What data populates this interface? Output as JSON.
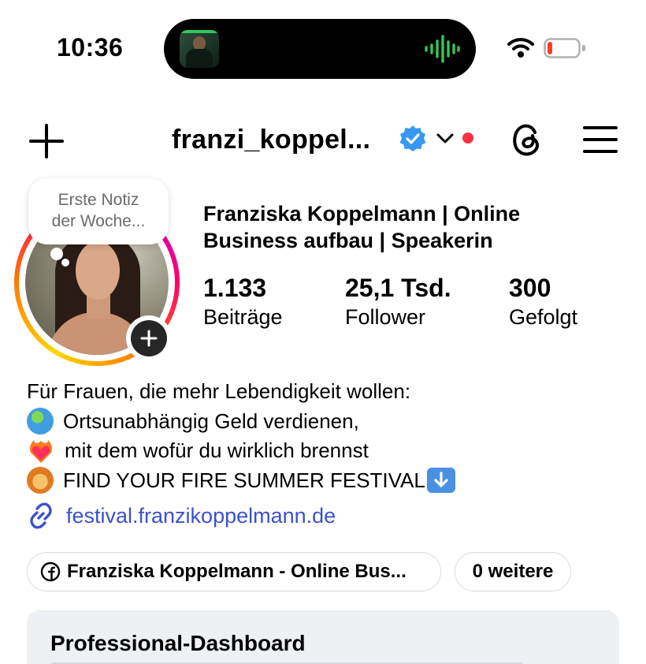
{
  "status_bar": {
    "time": "10:36"
  },
  "header": {
    "username": "franzi_koppel...",
    "verified": true,
    "notification_dot_color": "#ff3040"
  },
  "profile": {
    "note": {
      "line1": "Erste Notiz",
      "line2": "der Woche..."
    },
    "display_name": "Franziska Koppelmann | Online Business aufbau | Speakerin",
    "stats": [
      {
        "value": "1.133",
        "label": "Beiträge"
      },
      {
        "value": "25,1 Tsd.",
        "label": "Follower"
      },
      {
        "value": "300",
        "label": "Gefolgt"
      }
    ]
  },
  "bio": {
    "line1": "Für Frauen, die mehr Lebendigkeit wollen:",
    "line2": "Ortsunabhängig Geld verdienen,",
    "line3": "mit dem wofür du wirklich brennst",
    "line4": "FIND YOUR FIRE SUMMER FESTIVAL",
    "emojis": [
      "globe-emoji",
      "heart-on-fire-emoji",
      "lion-emoji",
      "down-arrow-emoji"
    ]
  },
  "link": {
    "text": "festival.franzikoppelmann.de",
    "color": "#3c52c9"
  },
  "chips": {
    "facebook": "Franziska Koppelmann - Online Bus...",
    "more": "0 weitere"
  },
  "dashboard": {
    "title": "Professional-Dashboard"
  }
}
